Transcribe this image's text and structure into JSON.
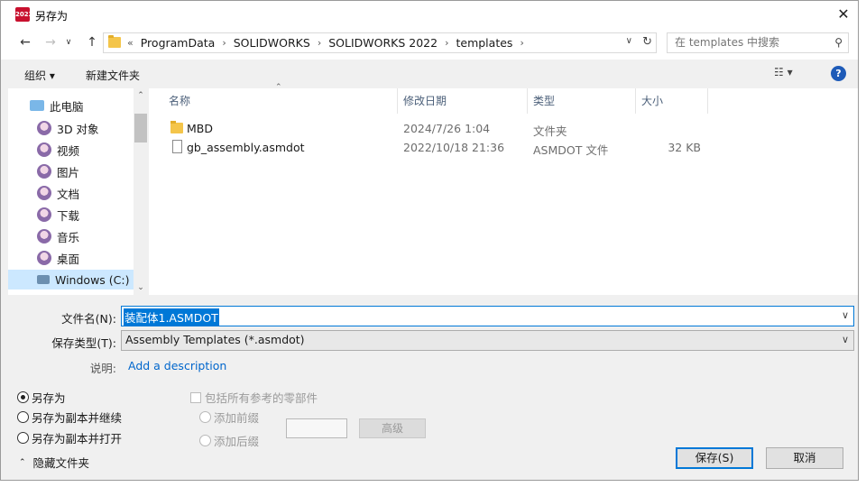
{
  "window": {
    "title": "另存为",
    "app_icon_label": "2022",
    "close_label": "✕"
  },
  "nav": {
    "back_icon": "←",
    "forward_icon": "→",
    "recent_icon": "∨",
    "up_icon": "↑",
    "breadcrumb_lead": "«",
    "breadcrumb": [
      "ProgramData",
      "SOLIDWORKS",
      "SOLIDWORKS 2022",
      "templates"
    ],
    "breadcrumb_sep": "›",
    "dropdown_icon": "∨",
    "refresh_icon": "↻",
    "search_placeholder": "在 templates 中搜索",
    "search_icon": "⚲"
  },
  "toolbar": {
    "organize_label": "组织 ▾",
    "new_folder_label": "新建文件夹",
    "view_label": "☷ ▾",
    "help_label": "?"
  },
  "sidebar": {
    "items": [
      {
        "label": "此电脑",
        "icon": "computer-icon"
      },
      {
        "label": "3D 对象",
        "icon": "3d-objects-icon"
      },
      {
        "label": "视频",
        "icon": "videos-icon"
      },
      {
        "label": "图片",
        "icon": "pictures-icon"
      },
      {
        "label": "文档",
        "icon": "documents-icon"
      },
      {
        "label": "下载",
        "icon": "downloads-icon"
      },
      {
        "label": "音乐",
        "icon": "music-icon"
      },
      {
        "label": "桌面",
        "icon": "desktop-icon"
      },
      {
        "label": "Windows (C:)",
        "icon": "drive-icon"
      }
    ],
    "scroll_up": "⌃",
    "scroll_down": "⌄"
  },
  "files": {
    "columns": [
      "名称",
      "修改日期",
      "类型",
      "大小"
    ],
    "sort_indicator": "⌃",
    "rows": [
      {
        "name": "MBD",
        "modified": "2024/7/26 1:04",
        "type": "文件夹",
        "size": "",
        "kind": "folder"
      },
      {
        "name": "gb_assembly.asmdot",
        "modified": "2022/10/18 21:36",
        "type": "ASMDOT 文件",
        "size": "32 KB",
        "kind": "file"
      }
    ]
  },
  "form": {
    "filename_label": "文件名(N):",
    "filename_value": "装配体1.ASMDOT",
    "filetype_label": "保存类型(T):",
    "filetype_value": "Assembly Templates (*.asmdot)",
    "description_label": "说明:",
    "description_link": "Add a description",
    "dropdown_icon": "∨"
  },
  "options": {
    "save_as": "另存为",
    "save_copy_continue": "另存为副本并继续",
    "save_copy_open": "另存为副本并打开",
    "include_refs": "包括所有参考的零部件",
    "add_prefix": "添加前缀",
    "add_suffix": "添加后缀",
    "advanced": "高级"
  },
  "footer": {
    "hide_folders": "隐藏文件夹",
    "hide_chevron": "⌃",
    "save_button": "保存(S)",
    "cancel_button": "取消"
  }
}
